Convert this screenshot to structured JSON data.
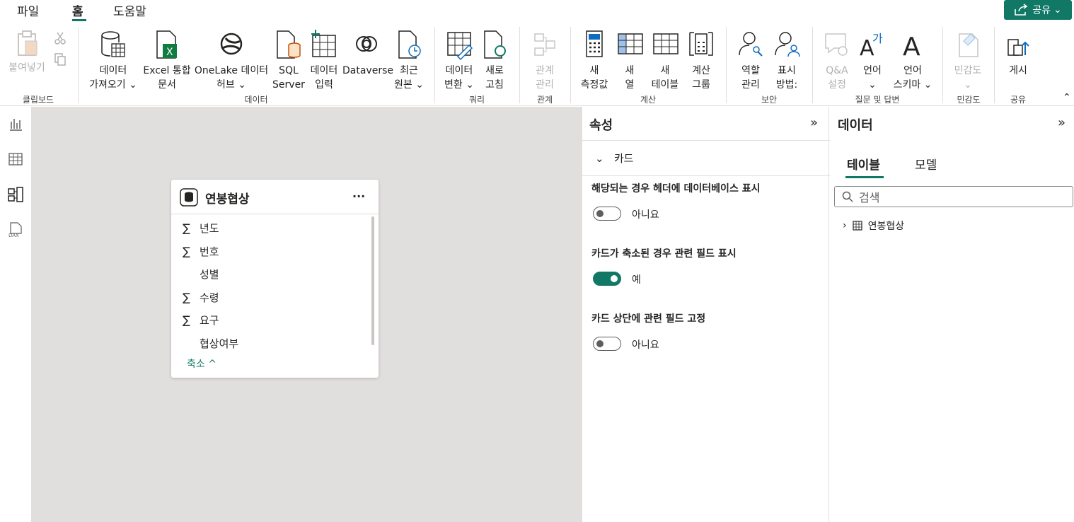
{
  "menubar": {
    "tabs": [
      "파일",
      "홈",
      "도움말"
    ],
    "active_tab": "홈",
    "share_label": "공유"
  },
  "ribbon": {
    "clipboard": {
      "paste": "붙여넣기",
      "group": "클립보드"
    },
    "data": {
      "get_data": [
        "데이터",
        "가져오기"
      ],
      "excel": [
        "Excel 통합",
        "문서"
      ],
      "onelake": [
        "OneLake 데이터",
        "허브"
      ],
      "sql": [
        "SQL",
        "Server"
      ],
      "enter_data": [
        "데이터",
        "입력"
      ],
      "dataverse": "Dataverse",
      "recent": [
        "최근",
        "원본"
      ],
      "group": "데이터"
    },
    "query": {
      "transform": [
        "데이터",
        "변환"
      ],
      "refresh": [
        "새로",
        "고침"
      ],
      "group": "쿼리"
    },
    "relationships": {
      "manage": [
        "관계",
        "관리"
      ],
      "group": "관계"
    },
    "calculations": {
      "measure": [
        "새",
        "측정값"
      ],
      "column": [
        "새",
        "열"
      ],
      "table": [
        "새",
        "테이블"
      ],
      "calc_group": [
        "계산",
        "그룹"
      ],
      "group": "계산"
    },
    "security": {
      "roles": [
        "역할",
        "관리"
      ],
      "view_as": [
        "표시",
        "방법:"
      ],
      "group": "보안"
    },
    "qa": {
      "qa_setup": [
        "Q&A",
        "설정"
      ],
      "language": "언어",
      "lang_schema": [
        "언어",
        "스키마"
      ],
      "group": "질문 및 답변"
    },
    "sensitivity": {
      "label": "민감도",
      "group": "민감도"
    },
    "share": {
      "publish": "게시",
      "group": "공유"
    }
  },
  "card": {
    "title": "연봉협상",
    "more": "···",
    "fields": [
      {
        "sigma": "∑",
        "name": "년도"
      },
      {
        "sigma": "∑",
        "name": "번호"
      },
      {
        "sigma": "",
        "name": "성별"
      },
      {
        "sigma": "∑",
        "name": "수령"
      },
      {
        "sigma": "∑",
        "name": "요구"
      },
      {
        "sigma": "",
        "name": "협상여부"
      }
    ],
    "collapse": "축소 ^"
  },
  "properties": {
    "title": "속성",
    "section": "카드",
    "settings": [
      {
        "label": "해당되는 경우 헤더에 데이터베이스 표시",
        "value": "아니요",
        "on": false
      },
      {
        "label": "카드가 축소된 경우 관련 필드 표시",
        "value": "예",
        "on": true
      },
      {
        "label": "카드 상단에 관련 필드 고정",
        "value": "아니요",
        "on": false
      }
    ]
  },
  "datapane": {
    "title": "데이터",
    "tabs": [
      "테이블",
      "모델"
    ],
    "search_placeholder": "검색",
    "tables": [
      "연봉협상"
    ]
  },
  "colors": {
    "accent": "#117865"
  }
}
